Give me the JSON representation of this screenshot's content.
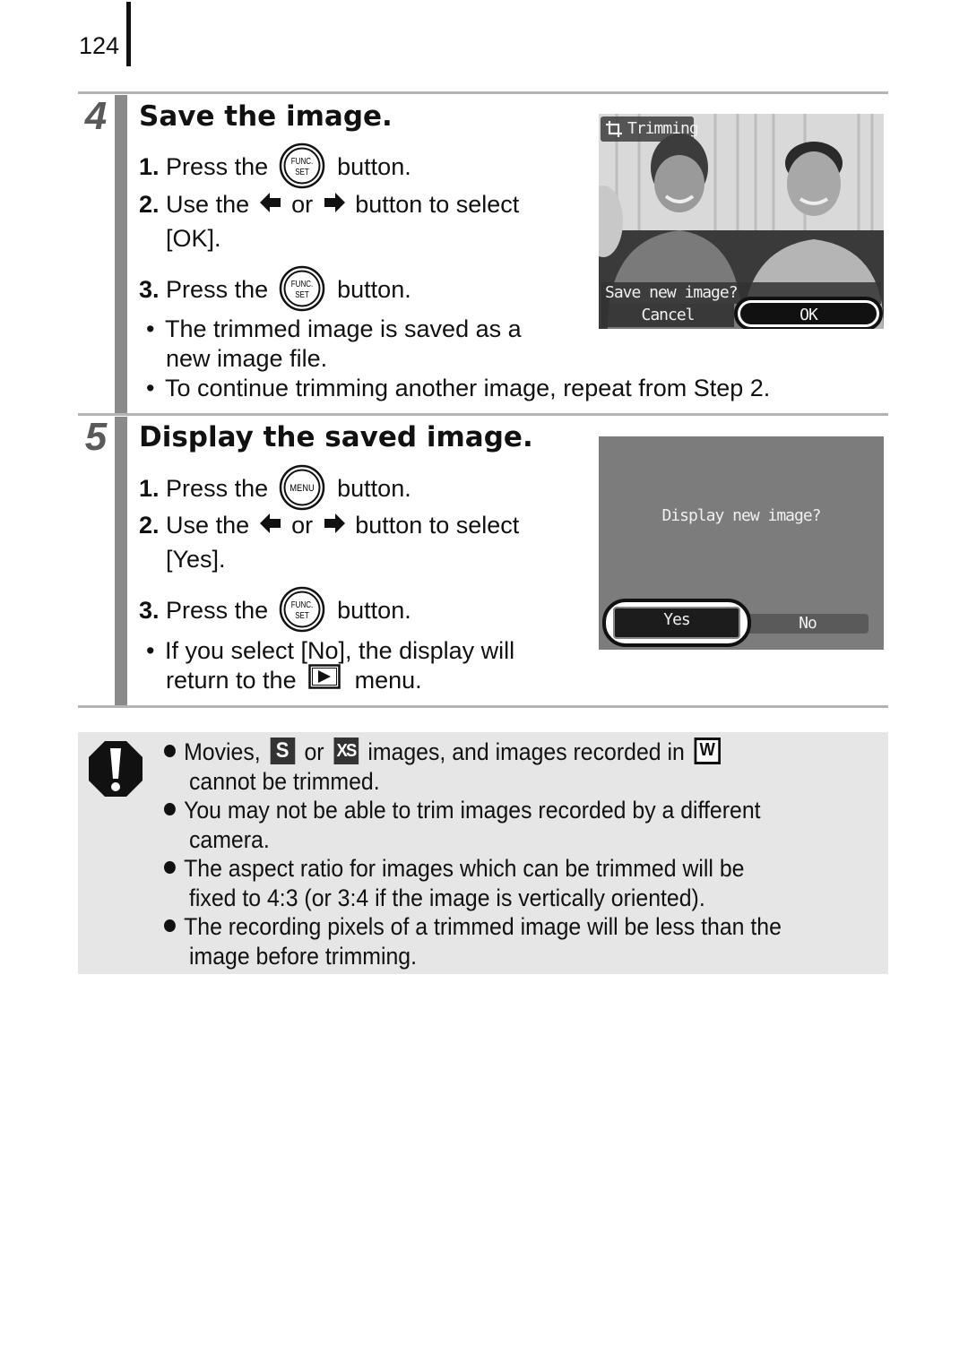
{
  "page": {
    "number": "124"
  },
  "steps": [
    {
      "number": "4",
      "title": "Save the image.",
      "instructions": [
        {
          "num": "1.",
          "pre": "Press the",
          "icon": "func-set-button-icon",
          "icon_text_top": "FUNC.",
          "icon_text_bottom": "SET",
          "post": "button."
        },
        {
          "num": "2.",
          "pre": "Use the",
          "mid": "or",
          "post": "button to select",
          "cont": "[OK]."
        },
        {
          "num": "3.",
          "pre": "Press the",
          "icon": "func-set-button-icon",
          "icon_text_top": "FUNC.",
          "icon_text_bottom": "SET",
          "post": "button."
        }
      ],
      "notes": [
        {
          "line1": "The trimmed image is saved as a",
          "line2": "new image file."
        },
        {
          "line1": "To continue trimming another image, repeat from Step 2."
        }
      ],
      "screen": {
        "mode_label": "Trimming",
        "prompt": "Save new image?",
        "options": [
          "Cancel",
          "OK"
        ],
        "selected": "OK"
      }
    },
    {
      "number": "5",
      "title": "Display the saved image.",
      "instructions": [
        {
          "num": "1.",
          "pre": "Press the",
          "icon": "menu-button-icon",
          "icon_text": "MENU",
          "post": "button."
        },
        {
          "num": "2.",
          "pre": "Use the",
          "mid": "or",
          "post": "button to select",
          "cont": "[Yes]."
        },
        {
          "num": "3.",
          "pre": "Press the",
          "icon": "func-set-button-icon",
          "icon_text_top": "FUNC.",
          "icon_text_bottom": "SET",
          "post": "button."
        }
      ],
      "notes": [
        {
          "line1": "If you select [No], the display will",
          "line2_pre": "return to the",
          "line2_post": "menu."
        }
      ],
      "screen": {
        "prompt": "Display new image?",
        "options": [
          "Yes",
          "No"
        ],
        "selected": "Yes"
      }
    }
  ],
  "caution": {
    "items": [
      {
        "l1_a": "Movies,",
        "icon_s": "S",
        "l1_b": "or",
        "icon_xs": "XS",
        "l1_c": "images, and images recorded in",
        "icon_w": "W",
        "l2": "cannot be trimmed."
      },
      {
        "l1": "You may not be able to trim images recorded by a different",
        "l2": "camera."
      },
      {
        "l1": "The aspect ratio for images which can be trimmed will be",
        "l2": "fixed to 4:3 (or 3:4 if the image is vertically oriented)."
      },
      {
        "l1": "The recording pixels of a trimmed image will be less than the",
        "l2": "image before trimming."
      }
    ]
  }
}
